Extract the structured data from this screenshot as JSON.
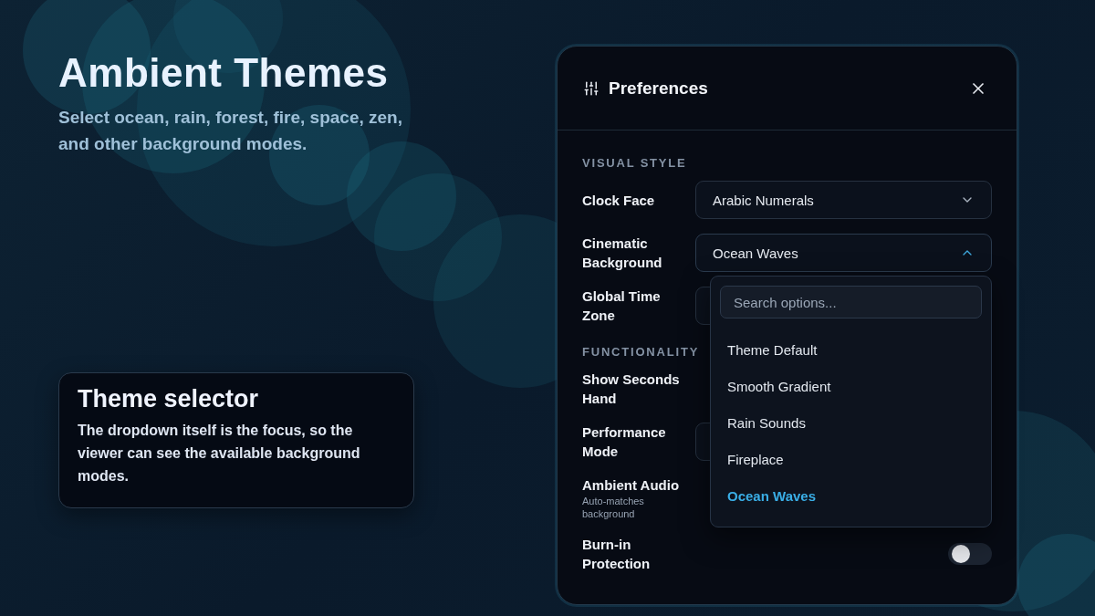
{
  "hero": {
    "title": "Ambient Themes",
    "subtitle": "Select ocean, rain, forest, fire, space, zen, and other background modes."
  },
  "note_card": {
    "title": "Theme selector",
    "body": "The dropdown itself is the focus, so the viewer can see the available background modes."
  },
  "panel": {
    "title": "Preferences",
    "sections": [
      {
        "heading": "VISUAL STYLE",
        "rows": [
          {
            "kind": "select",
            "label": "Clock Face",
            "value": "Arabic Numerals",
            "expanded": false
          },
          {
            "kind": "select",
            "label": "Cinematic Background",
            "value": "Ocean Waves",
            "expanded": true,
            "search_placeholder": "Search options...",
            "options": [
              {
                "label": "Theme Default",
                "selected": false
              },
              {
                "label": "Smooth Gradient",
                "selected": false
              },
              {
                "label": "Rain Sounds",
                "selected": false
              },
              {
                "label": "Fireplace",
                "selected": false
              },
              {
                "label": "Ocean Waves",
                "selected": true
              }
            ]
          },
          {
            "kind": "select",
            "label": "Global Time Zone",
            "expanded": false
          }
        ]
      },
      {
        "heading": "FUNCTIONALITY",
        "rows": [
          {
            "kind": "toggle",
            "label": "Show Seconds Hand"
          },
          {
            "kind": "select",
            "label": "Performance Mode",
            "expanded": false
          },
          {
            "kind": "toggle",
            "label": "Ambient Audio",
            "hint": "Auto-matches background"
          },
          {
            "kind": "toggle",
            "label": "Burn-in Protection",
            "on": false
          }
        ]
      }
    ]
  }
}
